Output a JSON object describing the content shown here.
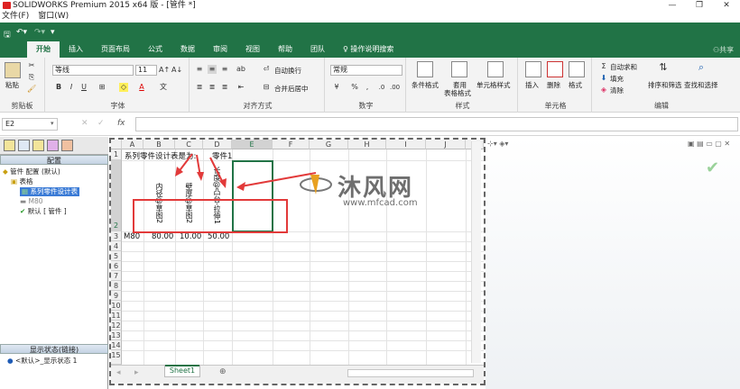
{
  "window": {
    "title": "SOLIDWORKS Premium 2015 x64 版 - [管件 *]",
    "controls": [
      "—",
      "❐",
      "✕"
    ]
  },
  "menubar": {
    "items": [
      "文件(F)",
      "窗口(W)"
    ]
  },
  "ribbon": {
    "tabs": [
      "开始",
      "插入",
      "页面布局",
      "公式",
      "数据",
      "审阅",
      "视图",
      "帮助",
      "团队",
      "操作说明搜索"
    ],
    "active_tab": "开始",
    "share_label": "共享",
    "clipboard": {
      "paste_label": "粘贴",
      "group_label": "剪贴板"
    },
    "font": {
      "font_name": "等线",
      "font_size": "11",
      "bold": "B",
      "italic": "I",
      "underline": "U",
      "group_label": "字体"
    },
    "alignment": {
      "wrap_label": "自动换行",
      "merge_label": "合并后居中",
      "group_label": "对齐方式"
    },
    "number": {
      "format_value": "常规",
      "percent": "%",
      "group_label": "数字"
    },
    "styles": {
      "conditional_label": "条件格式",
      "table_label_1": "套用",
      "table_label_2": "表格格式",
      "cell_style_label": "单元格样式",
      "group_label": "样式"
    },
    "cells": {
      "insert_label": "插入",
      "delete_label": "删除",
      "format_label": "格式",
      "group_label": "单元格"
    },
    "editing": {
      "autosum_label": "自动求和",
      "fill_label": "填充",
      "clear_label": "清除",
      "sort_label": "排序和筛选",
      "find_label": "查找和选择",
      "group_label": "编辑"
    }
  },
  "formula_bar": {
    "name_box": "E2",
    "fx": "fx",
    "value": ""
  },
  "left_panel": {
    "header": "配置",
    "tree": [
      {
        "label": "管件 配置 (默认)"
      },
      {
        "label": "表格"
      },
      {
        "label": "系列零件设计表"
      },
      {
        "label": "M80"
      },
      {
        "label": "默认 [ 管件 ]"
      }
    ],
    "display_header": "显示状态(链接)",
    "display_item": "<默认>_显示状态 1"
  },
  "sheet": {
    "columns": [
      "A",
      "B",
      "C",
      "D",
      "E",
      "F",
      "G",
      "H",
      "I",
      "J"
    ],
    "rows": [
      "1",
      "2",
      "3",
      "4",
      "5",
      "6",
      "7",
      "8",
      "9",
      "10",
      "11",
      "12",
      "13",
      "14",
      "15"
    ],
    "a1_text": "系列零件设计表是为:",
    "d1_text": "零件1",
    "headers": [
      "内径@草图2",
      "壁厚@草图2",
      "长度@凸台-拉伸1"
    ],
    "row3": [
      "M80",
      "80.00",
      "10.00",
      "50.00"
    ],
    "tab_name": "Sheet1",
    "add_sheet": "⊕"
  },
  "watermark": {
    "brand": "沐风网",
    "url": "www.mfcad.com"
  },
  "colors": {
    "excel_green": "#217346",
    "annotation_red": "#e23a3a"
  }
}
